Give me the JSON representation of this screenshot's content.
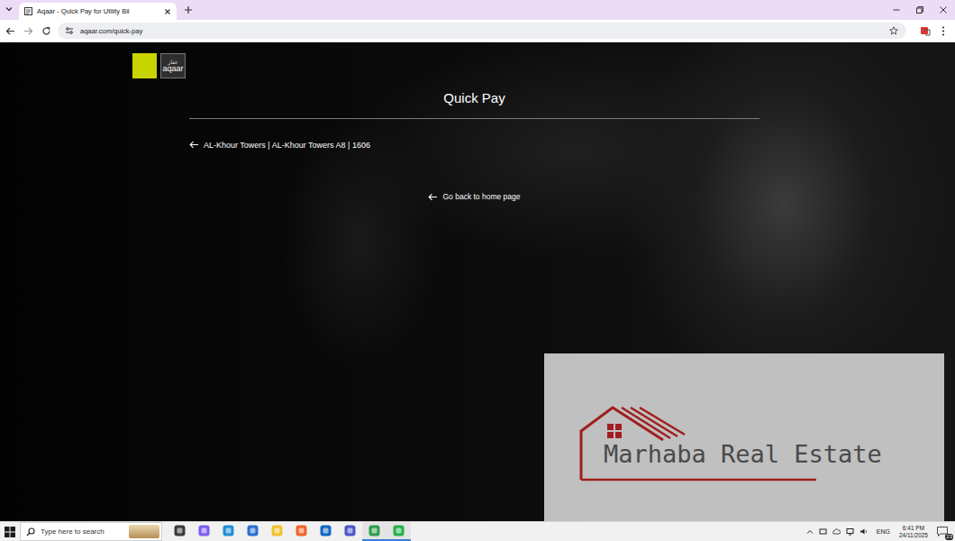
{
  "browser": {
    "tabs": [
      {
        "title": "Aqaar - Quick Pay for Utility Bil",
        "selected": true
      }
    ],
    "url": "aqaar.com/quick-pay"
  },
  "page": {
    "logo_arabic": "عقار",
    "logo_text": "aqaar",
    "title": "Quick Pay",
    "property_link": "AL-Khour Towers | AL-Khour Towers A8 | 1606",
    "home_link": "Go back to home page"
  },
  "watermark": {
    "text": "Marhaba Real Estate"
  },
  "taskbar": {
    "search_placeholder": "Type here to search",
    "apps": [
      {
        "name": "task-view",
        "active": false,
        "color": "#3a3a3a"
      },
      {
        "name": "copilot",
        "active": false,
        "color": "#7b5cf0"
      },
      {
        "name": "edge",
        "active": false,
        "color": "#1f8fd6"
      },
      {
        "name": "store",
        "active": false,
        "color": "#2a6fd1"
      },
      {
        "name": "files",
        "active": false,
        "color": "#f2c230"
      },
      {
        "name": "firefox",
        "active": false,
        "color": "#f0642b"
      },
      {
        "name": "outlook",
        "active": false,
        "color": "#1266c4"
      },
      {
        "name": "teams",
        "active": false,
        "color": "#4b56c9"
      },
      {
        "name": "chrome",
        "active": true,
        "color": "#2e9e4f"
      },
      {
        "name": "whatsapp",
        "active": true,
        "color": "#25b14a"
      }
    ],
    "language": "ENG",
    "time": "6:41 PM",
    "date": "24/11/2025",
    "notifications": "23"
  }
}
